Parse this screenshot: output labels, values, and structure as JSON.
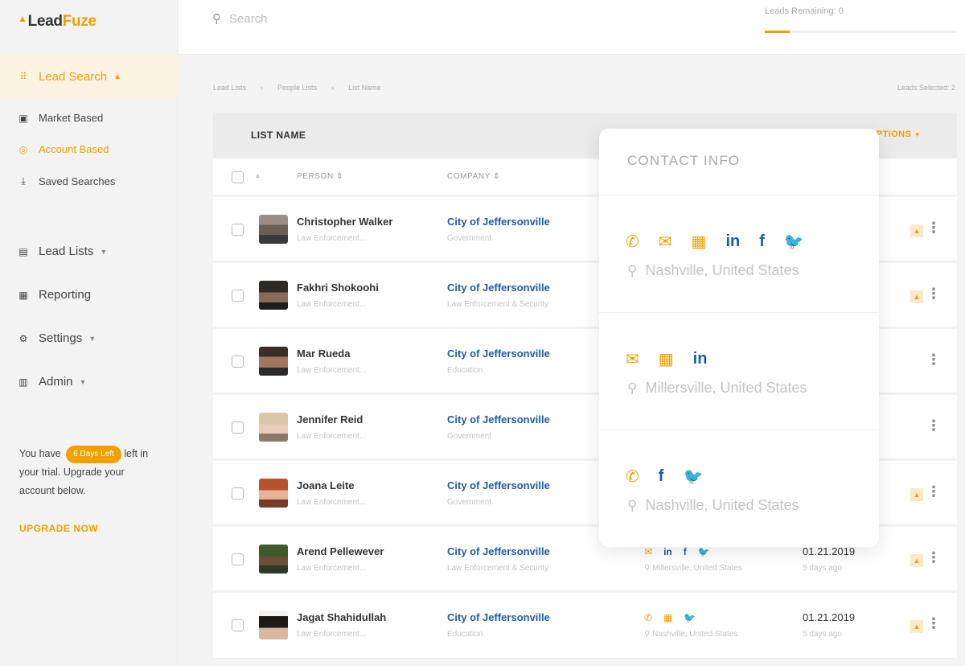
{
  "brand": {
    "logo_lead": "Lead",
    "logo_fuze": "Fuze"
  },
  "sidebar": {
    "active": "Lead Search",
    "sub_items": [
      "Market Based",
      "Account Based",
      "Saved Searches"
    ],
    "main_items": [
      "Lead Lists",
      "Reporting",
      "Settings",
      "Admin"
    ],
    "trial_prefix": "You have",
    "trial_badge": "6 Days Left",
    "trial_suffix": "left in your trial. Upgrade your account below.",
    "upgrade": "UPGRADE NOW"
  },
  "topbar": {
    "search_placeholder": "Search",
    "leads_remaining": "Leads Remaining: 0",
    "leads_progress": 0.13
  },
  "breadcrumbs": [
    "Lead Lists",
    "People Lists",
    "List Name"
  ],
  "leads_selected": "Leads Selected: 2",
  "list": {
    "header": "LIST NAME",
    "options": "OPTIONS"
  },
  "columns": {
    "person": "PERSON",
    "company": "COMPANY"
  },
  "rows": [
    {
      "name": "Christopher Walker",
      "title": "Law Enforcement...",
      "company": "City of Jeffersonville",
      "industry": "Government"
    },
    {
      "name": "Fakhri Shokoohi",
      "title": "Law Enforcement...",
      "company": "City of Jeffersonville",
      "industry": "Law Enforcement & Security"
    },
    {
      "name": "Mar Rueda",
      "title": "Law Enforcement...",
      "company": "City of Jeffersonville",
      "industry": "Education"
    },
    {
      "name": "Jennifer Reid",
      "title": "Law Enforcement...",
      "company": "City of Jeffersonville",
      "industry": "Government"
    },
    {
      "name": "Joana Leite",
      "title": "Law Enforcement...",
      "company": "City of Jeffersonville",
      "industry": "Government"
    },
    {
      "name": "Arend Pellewever",
      "title": "Law Enforcement...",
      "company": "City of Jeffersonville",
      "industry": "Law Enforcement & Security",
      "location": "Millersville, United States",
      "date": "01.21.2019",
      "ago": "5 days ago"
    },
    {
      "name": "Jagat Shahidullah",
      "title": "Law Enforcement...",
      "company": "City of Jeffersonville",
      "industry": "Education",
      "location": "Nashville, United States",
      "date": "01.21.2019",
      "ago": "5 days ago"
    }
  ],
  "popup": {
    "title": "CONTACT INFO",
    "entries": [
      {
        "location": "Nashville, United States"
      },
      {
        "location": "Millersville, United States"
      },
      {
        "location": "Nashville, United States"
      }
    ]
  },
  "colors": {
    "accent": "#f0a000",
    "link": "#1e5aa8",
    "twitter": "#1da1f2"
  },
  "icons": [
    "grid-icon",
    "briefcase-icon",
    "target-icon",
    "download-icon",
    "clipboard-icon",
    "chart-icon",
    "gear-icon",
    "admin-icon",
    "search-icon",
    "phone-icon",
    "email-icon",
    "building-icon",
    "linkedin-icon",
    "facebook-icon",
    "twitter-icon",
    "pin-icon",
    "flag-icon",
    "more-icon"
  ]
}
